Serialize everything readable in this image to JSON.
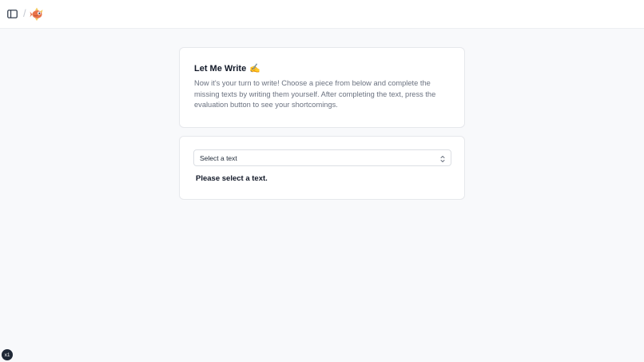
{
  "header": {
    "sidebar_toggle_icon": "sidebar-toggle-icon",
    "separator": "/",
    "logo_icon": "fish-mascot-icon"
  },
  "intro_card": {
    "title": "Let Me Write",
    "title_emoji": "✍️",
    "description": "Now it's your turn to write! Choose a piece from below and complete the missing texts by writing them yourself. After completing the text, press the evaluation button to see your shortcomings."
  },
  "select_card": {
    "select_value": "Select a text",
    "status_message": "Please select a text."
  },
  "footer": {
    "badge_label": "x1"
  },
  "colors": {
    "page_background": "#f8f9fb",
    "card_background": "#ffffff",
    "muted_text": "#6b7280",
    "badge_background": "#1f2937"
  }
}
